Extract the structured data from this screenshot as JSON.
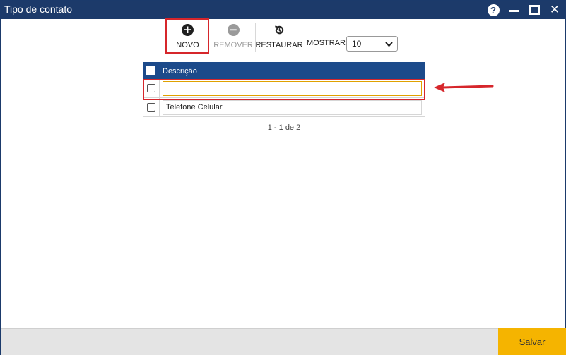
{
  "window": {
    "title": "Tipo de contato",
    "help_glyph": "?",
    "close_glyph": "✕"
  },
  "toolbar": {
    "novo_label": "NOVO",
    "novo_icon": "plus-circle-icon",
    "remover_label": "REMOVER",
    "remover_icon": "minus-circle-icon",
    "restaurar_label": "RESTAURAR",
    "restaurar_icon": "restore-icon",
    "mostrar_label": "MOSTRAR:",
    "page_size": "10",
    "page_size_options": [
      "10"
    ]
  },
  "grid": {
    "columns": [
      "Descrição"
    ],
    "rows": [
      {
        "descricao": ""
      },
      {
        "descricao": "Telefone Celular"
      }
    ]
  },
  "pager": {
    "text": "1 - 1 de 2"
  },
  "footer": {
    "save_label": "Salvar"
  },
  "colors": {
    "titlebar": "#1c3a6a",
    "grid_header": "#1c4a8a",
    "highlight": "#d6262b",
    "save_button": "#f5b400",
    "input_focus_border": "#e0a100"
  }
}
